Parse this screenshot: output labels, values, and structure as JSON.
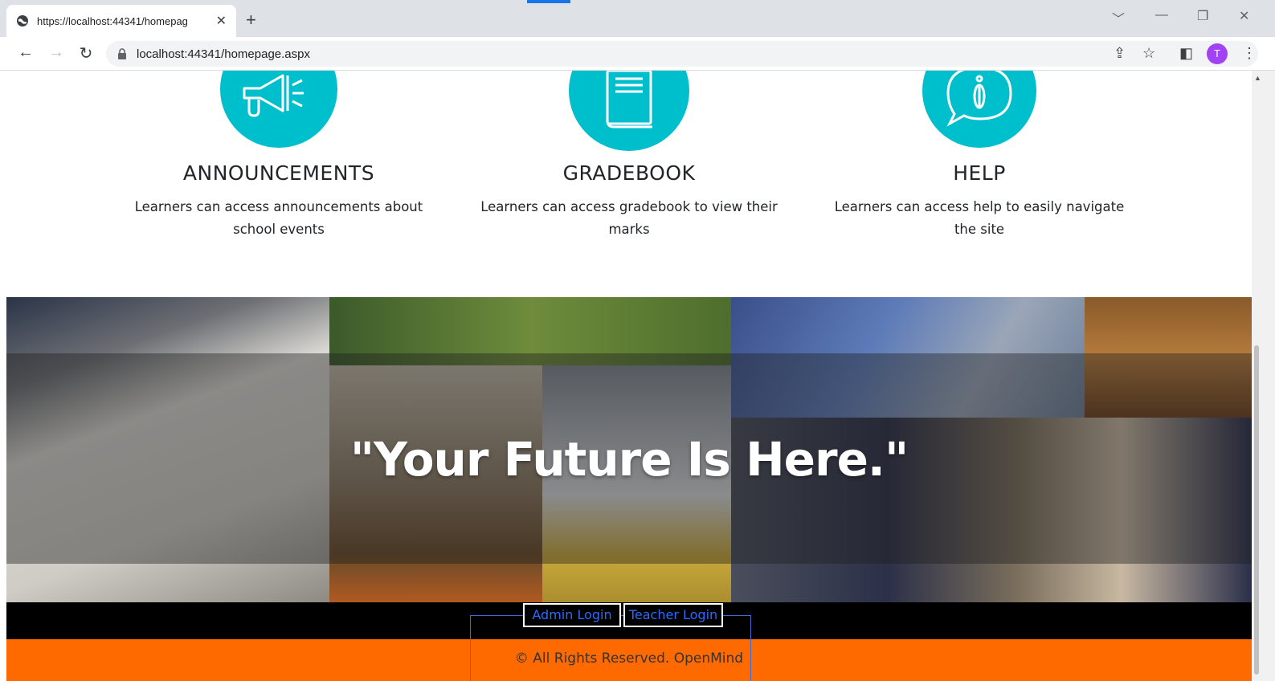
{
  "browser": {
    "tab_title": "https://localhost:44341/homepag",
    "url": "localhost:44341/homepage.aspx",
    "profile_initial": "T",
    "profile_color": "#a142f4"
  },
  "features": [
    {
      "title": "ANNOUNCEMENTS",
      "description": "Learners can access announcements about school events",
      "icon": "megaphone-icon"
    },
    {
      "title": "GRADEBOOK",
      "description": "Learners can access gradebook to view their marks",
      "icon": "book-icon"
    },
    {
      "title": "HELP",
      "description": "Learners can access help to easily navigate the site",
      "icon": "info-bubble-icon"
    }
  ],
  "banner": {
    "headline": "\"Your Future Is Here.\""
  },
  "footer": {
    "admin_login": "Admin Login",
    "teacher_login": "Teacher Login",
    "copyright": "© All Rights Reserved. OpenMind",
    "bar_color": "#ff6a00"
  },
  "colors": {
    "accent": "#00bfcc",
    "link": "#2a6bff"
  }
}
